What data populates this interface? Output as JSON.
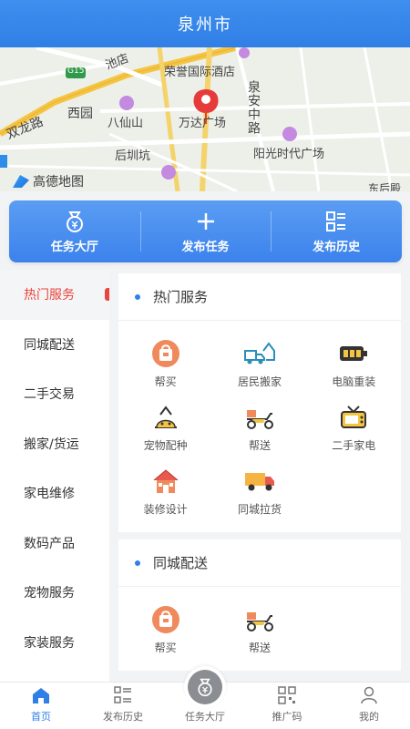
{
  "header": {
    "title": "泉州市"
  },
  "map": {
    "labels": {
      "chidian": "池店",
      "g15": "G15",
      "rongyu": "荣誉国际酒店",
      "shuanglong": "双龙路",
      "xiyuan": "西园",
      "baxian": "八仙山",
      "wanda": "万达广场",
      "quanan": "泉安中路",
      "houkeng": "后圳坑",
      "yangguang": "阳光时代广场",
      "donghu": "东后殿",
      "logo": "高德地图"
    }
  },
  "banner": {
    "items": [
      {
        "label": "任务大厅",
        "icon": "moneybag-icon"
      },
      {
        "label": "发布任务",
        "icon": "plus-icon"
      },
      {
        "label": "发布历史",
        "icon": "list-icon"
      }
    ]
  },
  "sidebar": {
    "items": [
      {
        "label": "热门服务",
        "active": true
      },
      {
        "label": "同城配送"
      },
      {
        "label": "二手交易"
      },
      {
        "label": "搬家/货运"
      },
      {
        "label": "家电维修"
      },
      {
        "label": "数码产品"
      },
      {
        "label": "宠物服务"
      },
      {
        "label": "家装服务"
      }
    ]
  },
  "sections": [
    {
      "title": "热门服务",
      "items": [
        {
          "label": "帮买",
          "icon": "shopping-bag-icon"
        },
        {
          "label": "居民搬家",
          "icon": "moving-truck-icon"
        },
        {
          "label": "电脑重装",
          "icon": "battery-icon"
        },
        {
          "label": "宠物配种",
          "icon": "pet-icon"
        },
        {
          "label": "帮送",
          "icon": "scooter-icon"
        },
        {
          "label": "二手家电",
          "icon": "tv-icon"
        },
        {
          "label": "装修设计",
          "icon": "house-icon"
        },
        {
          "label": "同城拉货",
          "icon": "truck-icon"
        }
      ]
    },
    {
      "title": "同城配送",
      "items": [
        {
          "label": "帮买",
          "icon": "shopping-bag-icon"
        },
        {
          "label": "帮送",
          "icon": "scooter-icon"
        }
      ]
    }
  ],
  "tabbar": {
    "items": [
      {
        "label": "首页",
        "icon": "home-icon",
        "active": true
      },
      {
        "label": "发布历史",
        "icon": "list-icon"
      },
      {
        "label": "任务大厅",
        "icon": "moneybag-icon"
      },
      {
        "label": "推广码",
        "icon": "qrcode-icon"
      },
      {
        "label": "我的",
        "icon": "user-icon"
      }
    ]
  },
  "colors": {
    "primary": "#2f7fe6",
    "accent": "#e8453c"
  }
}
